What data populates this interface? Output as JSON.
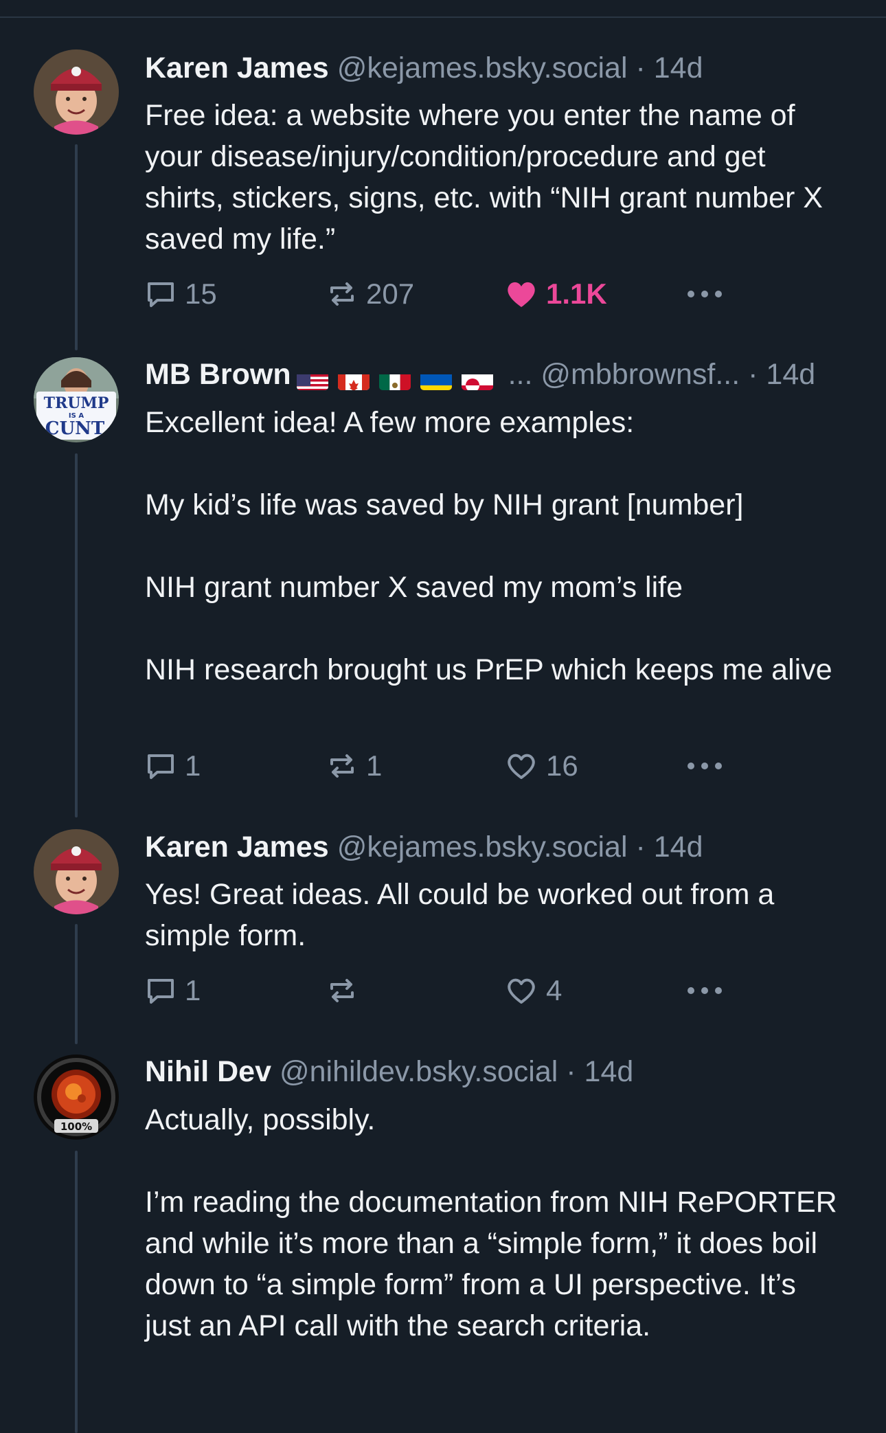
{
  "posts": [
    {
      "name": "Karen James",
      "handle": "@kejames.bsky.social",
      "time": "14d",
      "text": "Free idea: a website where you enter the name of your disease/injury/condition/procedure and get shirts, stickers, signs, etc. with “NIH grant number X saved my life.”",
      "replies": "15",
      "reposts": "207",
      "likes": "1.1K",
      "liked": true
    },
    {
      "name": "MB Brown",
      "flags": [
        "flag-us",
        "flag-ca",
        "flag-mx",
        "flag-ua",
        "flag-gl"
      ],
      "ellipsis": "...",
      "handle": "@mbbrownsf...",
      "time": "14d",
      "text": "Excellent idea! A few more examples:\n\nMy kid’s life was saved by NIH grant [number]\n\nNIH grant number X saved my mom’s life\n\nNIH research brought us PrEP which keeps me alive",
      "replies": "1",
      "reposts": "1",
      "likes": "16",
      "liked": false,
      "avatar_sign": [
        "TRUMP",
        "IS A",
        "CUNT"
      ]
    },
    {
      "name": "Karen James",
      "handle": "@kejames.bsky.social",
      "time": "14d",
      "text": "Yes! Great ideas. All could be worked out from a simple form.",
      "replies": "1",
      "reposts": "",
      "likes": "4",
      "liked": false
    },
    {
      "name": "Nihil Dev",
      "handle": "@nihildev.bsky.social",
      "time": "14d",
      "text": "Actually, possibly.\n\nI’m reading the documentation from NIH RePORTER and while it’s more than a “simple form,” it does boil down to “a simple form” from a UI perspective. It’s just an API call with the search criteria.",
      "avatar_badge": "100%"
    }
  ],
  "separator": "·",
  "colors": {
    "background": "#161e27",
    "muted": "#8b98a8",
    "like": "#ec4899",
    "thread": "#2f3d4d"
  }
}
